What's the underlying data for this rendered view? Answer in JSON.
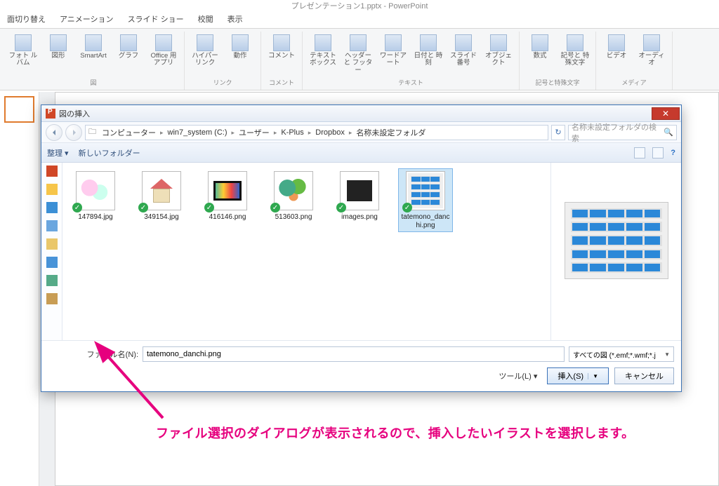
{
  "app": {
    "title": "プレゼンテーション1.pptx - PowerPoint"
  },
  "tabs": [
    "面切り替え",
    "アニメーション",
    "スライド ショー",
    "校閲",
    "表示"
  ],
  "ribbon": {
    "groups": [
      {
        "name": "図",
        "items": [
          {
            "label": "フォト\nルバム",
            "icon": "photo-album-icon"
          },
          {
            "label": "図形",
            "icon": "shapes-icon"
          },
          {
            "label": "SmartArt",
            "icon": "smartart-icon"
          },
          {
            "label": "グラフ",
            "icon": "chart-icon"
          },
          {
            "label": "Office 用\nアプリ",
            "icon": "apps-icon"
          }
        ]
      },
      {
        "name": "リンク",
        "items": [
          {
            "label": "ハイパーリンク",
            "icon": "hyperlink-icon"
          },
          {
            "label": "動作",
            "icon": "action-icon"
          }
        ]
      },
      {
        "name": "コメント",
        "items": [
          {
            "label": "コメント",
            "icon": "comment-icon"
          }
        ]
      },
      {
        "name": "テキスト",
        "items": [
          {
            "label": "テキスト\nボックス",
            "icon": "textbox-icon"
          },
          {
            "label": "ヘッダーと\nフッター",
            "icon": "header-footer-icon"
          },
          {
            "label": "ワードアート",
            "icon": "wordart-icon"
          },
          {
            "label": "日付と\n時刻",
            "icon": "datetime-icon"
          },
          {
            "label": "スライド番号",
            "icon": "slidenum-icon"
          },
          {
            "label": "オブジェクト",
            "icon": "object-icon"
          }
        ]
      },
      {
        "name": "記号と特殊文字",
        "items": [
          {
            "label": "数式",
            "icon": "equation-icon"
          },
          {
            "label": "記号と\n特殊文字",
            "icon": "symbol-icon"
          }
        ]
      },
      {
        "name": "メディア",
        "items": [
          {
            "label": "ビデオ",
            "icon": "video-icon"
          },
          {
            "label": "オーディオ",
            "icon": "audio-icon"
          }
        ]
      }
    ]
  },
  "dialog": {
    "title": "図の挿入",
    "breadcrumb": [
      "コンピューター",
      "win7_system (C:)",
      "ユーザー",
      "K-Plus",
      "Dropbox",
      "名称未設定フォルダ"
    ],
    "search_placeholder": "名称未設定フォルダの検索",
    "toolbar": {
      "organize": "整理",
      "newfolder": "新しいフォルダー"
    },
    "files": [
      {
        "name": "147894.jpg",
        "kind": "ppl"
      },
      {
        "name": "349154.jpg",
        "kind": "house"
      },
      {
        "name": "416146.png",
        "kind": "tv"
      },
      {
        "name": "513603.png",
        "kind": "park"
      },
      {
        "name": "images.png",
        "kind": "box"
      },
      {
        "name": "tatemono_danchi.png",
        "kind": "danchi",
        "selected": true
      }
    ],
    "filename_label": "ファイル名(N):",
    "filename_value": "tatemono_danchi.png",
    "filter": "すべての図 (*.emf;*.wmf;*.j",
    "tools": "ツール(L)",
    "insert": "挿入(S)",
    "cancel": "キャンセル"
  },
  "annotation": "ファイル選択のダイアログが表示されるので、挿入したいイラストを選択します。"
}
